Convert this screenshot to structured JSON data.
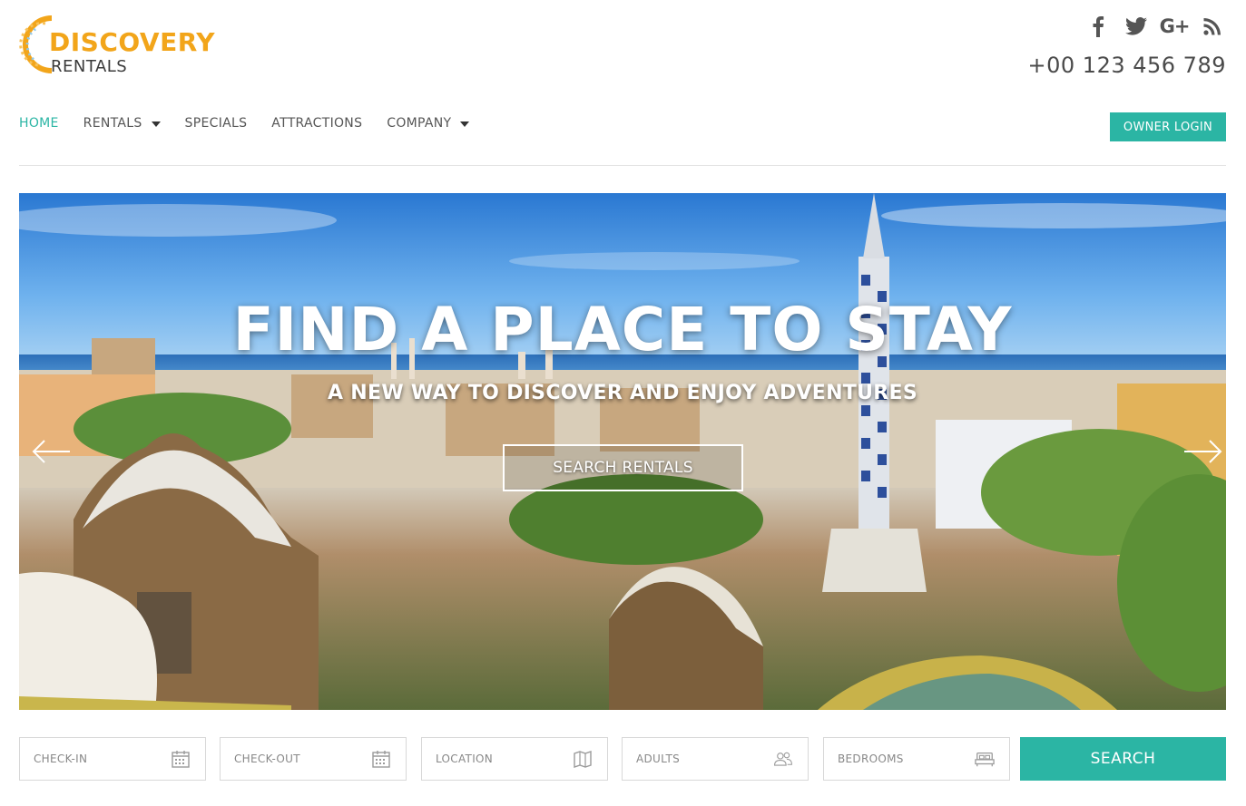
{
  "brand": {
    "name": "DISCOVERY",
    "tagline": "RENTALS",
    "primary_color": "#f2a51a",
    "accent_color": "#2bb5a4"
  },
  "header": {
    "social": [
      {
        "name": "facebook-icon"
      },
      {
        "name": "twitter-icon"
      },
      {
        "name": "google-plus-icon",
        "label": "G+"
      },
      {
        "name": "rss-icon"
      }
    ],
    "phone": "+00 123 456 789"
  },
  "nav": {
    "items": [
      {
        "label": "HOME",
        "active": true,
        "dropdown": false
      },
      {
        "label": "RENTALS",
        "active": false,
        "dropdown": true
      },
      {
        "label": "SPECIALS",
        "active": false,
        "dropdown": false
      },
      {
        "label": "ATTRACTIONS",
        "active": false,
        "dropdown": false
      },
      {
        "label": "COMPANY",
        "active": false,
        "dropdown": true
      }
    ],
    "owner_login": "OWNER LOGIN"
  },
  "hero": {
    "title": "FIND A PLACE TO STAY",
    "subtitle": "A NEW WAY TO DISCOVER AND ENJOY ADVENTURES",
    "cta": "SEARCH RENTALS",
    "prev_icon": "arrow-left-icon",
    "next_icon": "arrow-right-icon"
  },
  "search": {
    "fields": [
      {
        "label": "CHECK-IN",
        "icon": "calendar-icon"
      },
      {
        "label": "CHECK-OUT",
        "icon": "calendar-icon"
      },
      {
        "label": "LOCATION",
        "icon": "map-icon"
      },
      {
        "label": "ADULTS",
        "icon": "users-icon"
      },
      {
        "label": "BEDROOMS",
        "icon": "bed-icon"
      }
    ],
    "button": "SEARCH"
  }
}
